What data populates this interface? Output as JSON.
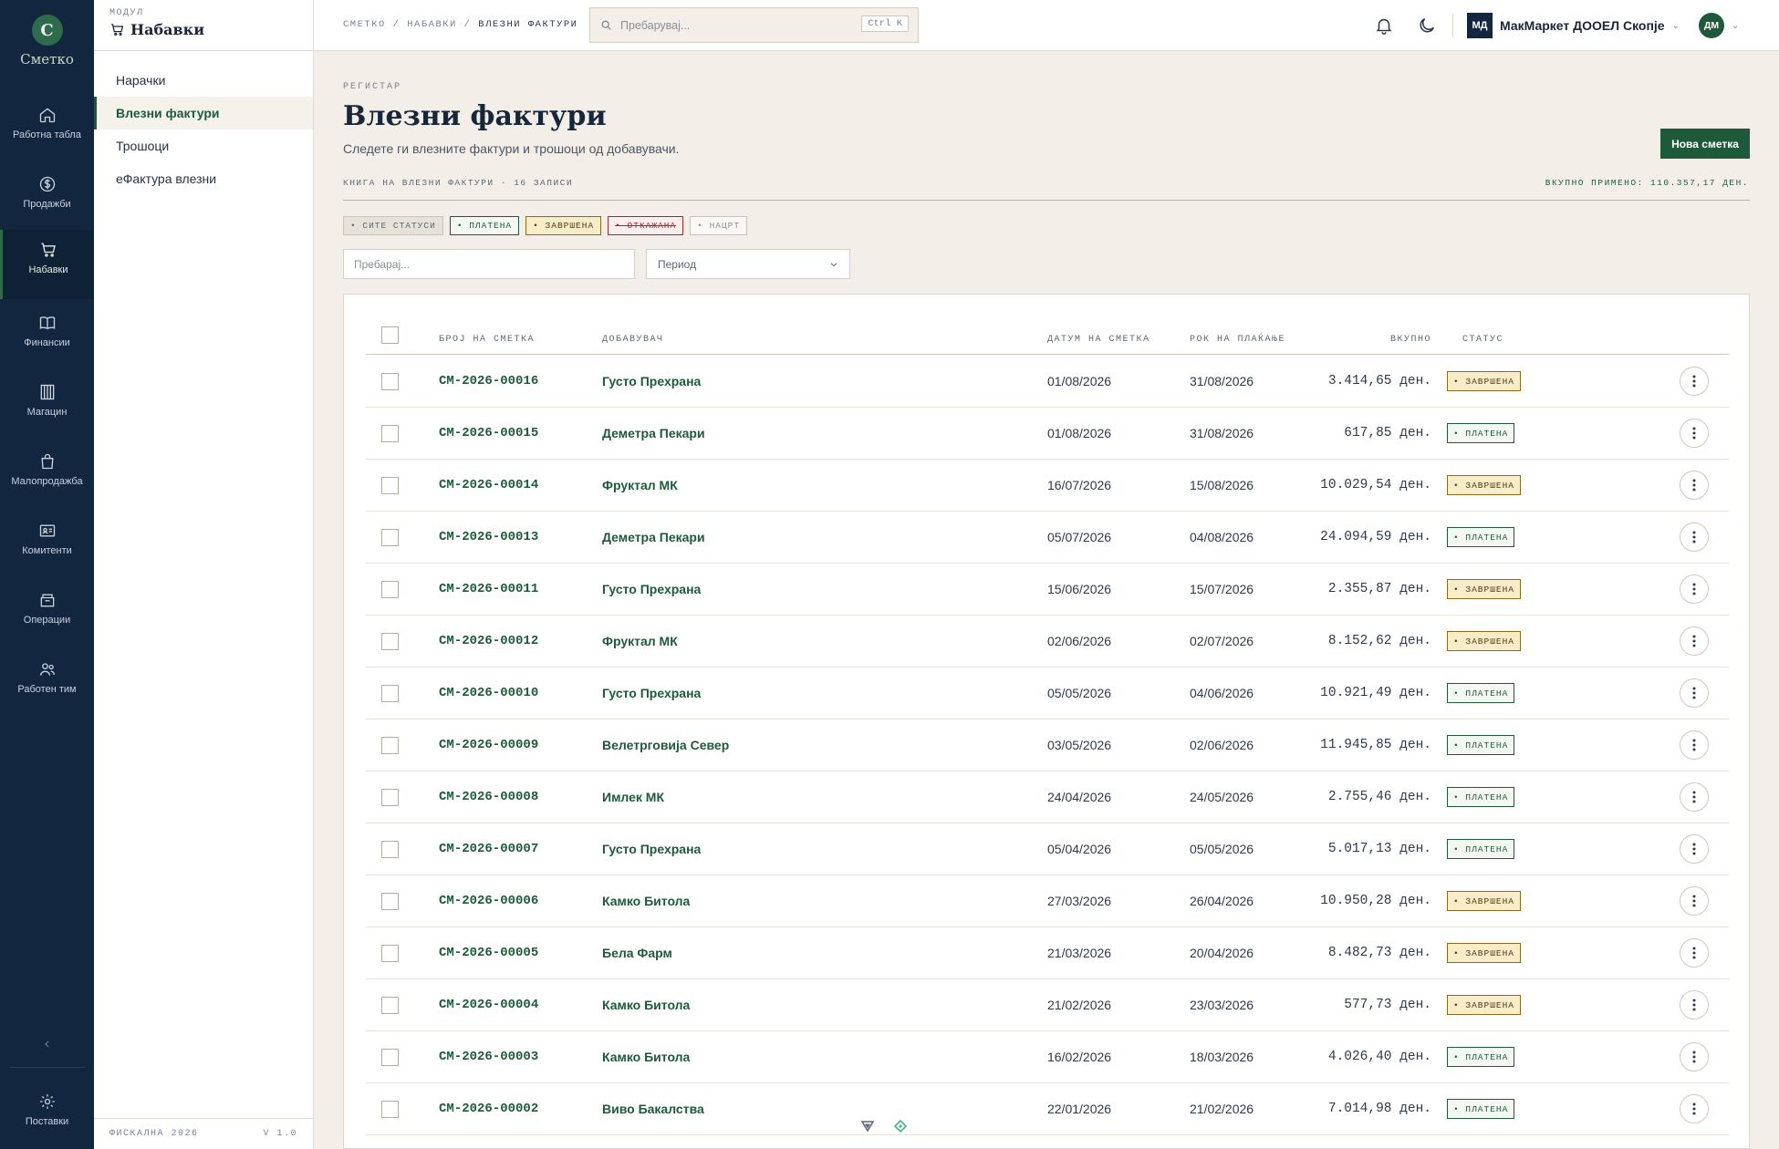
{
  "rail": {
    "logo_letter": "С",
    "logo_text": "Сметко",
    "items": [
      {
        "label": "Работна табла",
        "icon": "home-icon"
      },
      {
        "label": "Продажби",
        "icon": "dollar-icon"
      },
      {
        "label": "Набавки",
        "icon": "cart-icon",
        "active": true
      },
      {
        "label": "Финансии",
        "icon": "book-icon"
      },
      {
        "label": "Магацин",
        "icon": "warehouse-icon"
      },
      {
        "label": "Малопродажба",
        "icon": "bag-icon"
      },
      {
        "label": "Комитенти",
        "icon": "id-card-icon"
      },
      {
        "label": "Операции",
        "icon": "box-icon"
      },
      {
        "label": "Работен тим",
        "icon": "users-icon"
      }
    ],
    "collapse_glyph": "‹",
    "settings_label": "Поставки"
  },
  "module": {
    "kicker": "МОДУЛ",
    "title": "Набавки",
    "nav": [
      {
        "label": "Нарачки"
      },
      {
        "label": "Влезни фактури",
        "active": true
      },
      {
        "label": "Трошоци"
      },
      {
        "label": "еФактура влезни"
      }
    ],
    "footer_left": "ФИСКАЛНА 2026",
    "footer_right": "V 1.0"
  },
  "topbar": {
    "breadcrumb": [
      "СМЕТКО",
      "НАБАВКИ",
      "ВЛЕЗНИ ФАКТУРИ"
    ],
    "search_placeholder": "Пребарувај...",
    "search_shortcut": "Ctrl K",
    "company_initials": "МД",
    "company_name": "МакМаркет ДООЕЛ Скопје",
    "user_initials": "ДМ"
  },
  "page": {
    "kicker": "РЕГИСТАР",
    "title": "Влезни фактури",
    "subtitle": "Следете ги влезните фактури и трошоци од добавувачи.",
    "new_button": "Нова сметка",
    "book_label": "КНИГА НА ВЛЕЗНИ ФАКТУРИ",
    "records": "16 ЗАПИСИ",
    "total_label": "ВКУПНО ПРИМЕНО: 110.357,17 ДЕН."
  },
  "filters": {
    "chips": [
      "• СИТЕ СТАТУСИ",
      "• ПЛАТЕНА",
      "• ЗАВРШЕНА",
      "• ОТКАЖАНА",
      "• НАЦРТ"
    ],
    "search_placeholder": "Пребарај...",
    "period_placeholder": "Период"
  },
  "table": {
    "headers": [
      "БРОЈ НА СМЕТКА",
      "ДОБАВУВАЧ",
      "ДАТУМ НА СМЕТКА",
      "РОК НА ПЛАЌАЊЕ",
      "ВКУПНО",
      "СТАТУС"
    ],
    "rows": [
      {
        "number": "СМ-2026-00016",
        "supplier": "Густо Прехрана",
        "date": "01/08/2026",
        "due": "31/08/2026",
        "total": "3.414,65 ден.",
        "status": "• ЗАВРШЕНА",
        "kind": "done"
      },
      {
        "number": "СМ-2026-00015",
        "supplier": "Деметра Пекари",
        "date": "01/08/2026",
        "due": "31/08/2026",
        "total": "617,85 ден.",
        "status": "• ПЛАТЕНА",
        "kind": "paid"
      },
      {
        "number": "СМ-2026-00014",
        "supplier": "Фруктал МК",
        "date": "16/07/2026",
        "due": "15/08/2026",
        "total": "10.029,54 ден.",
        "status": "• ЗАВРШЕНА",
        "kind": "done"
      },
      {
        "number": "СМ-2026-00013",
        "supplier": "Деметра Пекари",
        "date": "05/07/2026",
        "due": "04/08/2026",
        "total": "24.094,59 ден.",
        "status": "• ПЛАТЕНА",
        "kind": "paid"
      },
      {
        "number": "СМ-2026-00011",
        "supplier": "Густо Прехрана",
        "date": "15/06/2026",
        "due": "15/07/2026",
        "total": "2.355,87 ден.",
        "status": "• ЗАВРШЕНА",
        "kind": "done"
      },
      {
        "number": "СМ-2026-00012",
        "supplier": "Фруктал МК",
        "date": "02/06/2026",
        "due": "02/07/2026",
        "total": "8.152,62 ден.",
        "status": "• ЗАВРШЕНА",
        "kind": "done"
      },
      {
        "number": "СМ-2026-00010",
        "supplier": "Густо Прехрана",
        "date": "05/05/2026",
        "due": "04/06/2026",
        "total": "10.921,49 ден.",
        "status": "• ПЛАТЕНА",
        "kind": "paid"
      },
      {
        "number": "СМ-2026-00009",
        "supplier": "Велетрговија Север",
        "date": "03/05/2026",
        "due": "02/06/2026",
        "total": "11.945,85 ден.",
        "status": "• ПЛАТЕНА",
        "kind": "paid"
      },
      {
        "number": "СМ-2026-00008",
        "supplier": "Имлек МК",
        "date": "24/04/2026",
        "due": "24/05/2026",
        "total": "2.755,46 ден.",
        "status": "• ПЛАТЕНА",
        "kind": "paid"
      },
      {
        "number": "СМ-2026-00007",
        "supplier": "Густо Прехрана",
        "date": "05/04/2026",
        "due": "05/05/2026",
        "total": "5.017,13 ден.",
        "status": "• ПЛАТЕНА",
        "kind": "paid"
      },
      {
        "number": "СМ-2026-00006",
        "supplier": "Камко Битола",
        "date": "27/03/2026",
        "due": "26/04/2026",
        "total": "10.950,28 ден.",
        "status": "• ЗАВРШЕНА",
        "kind": "done"
      },
      {
        "number": "СМ-2026-00005",
        "supplier": "Бела Фарм",
        "date": "21/03/2026",
        "due": "20/04/2026",
        "total": "8.482,73 ден.",
        "status": "• ЗАВРШЕНА",
        "kind": "done"
      },
      {
        "number": "СМ-2026-00004",
        "supplier": "Камко Битола",
        "date": "21/02/2026",
        "due": "23/03/2026",
        "total": "577,73 ден.",
        "status": "• ЗАВРШЕНА",
        "kind": "done"
      },
      {
        "number": "СМ-2026-00003",
        "supplier": "Камко Битола",
        "date": "16/02/2026",
        "due": "18/03/2026",
        "total": "4.026,40 ден.",
        "status": "• ПЛАТЕНА",
        "kind": "paid"
      },
      {
        "number": "СМ-2026-00002",
        "supplier": "Виво Бакалства",
        "date": "22/01/2026",
        "due": "21/02/2026",
        "total": "7.014,98 ден.",
        "status": "• ПЛАТЕНА",
        "kind": "paid"
      }
    ]
  },
  "colors": {
    "brand_green": "#1e5a3a",
    "rail_navy": "#132640",
    "background": "#f3efe8"
  }
}
